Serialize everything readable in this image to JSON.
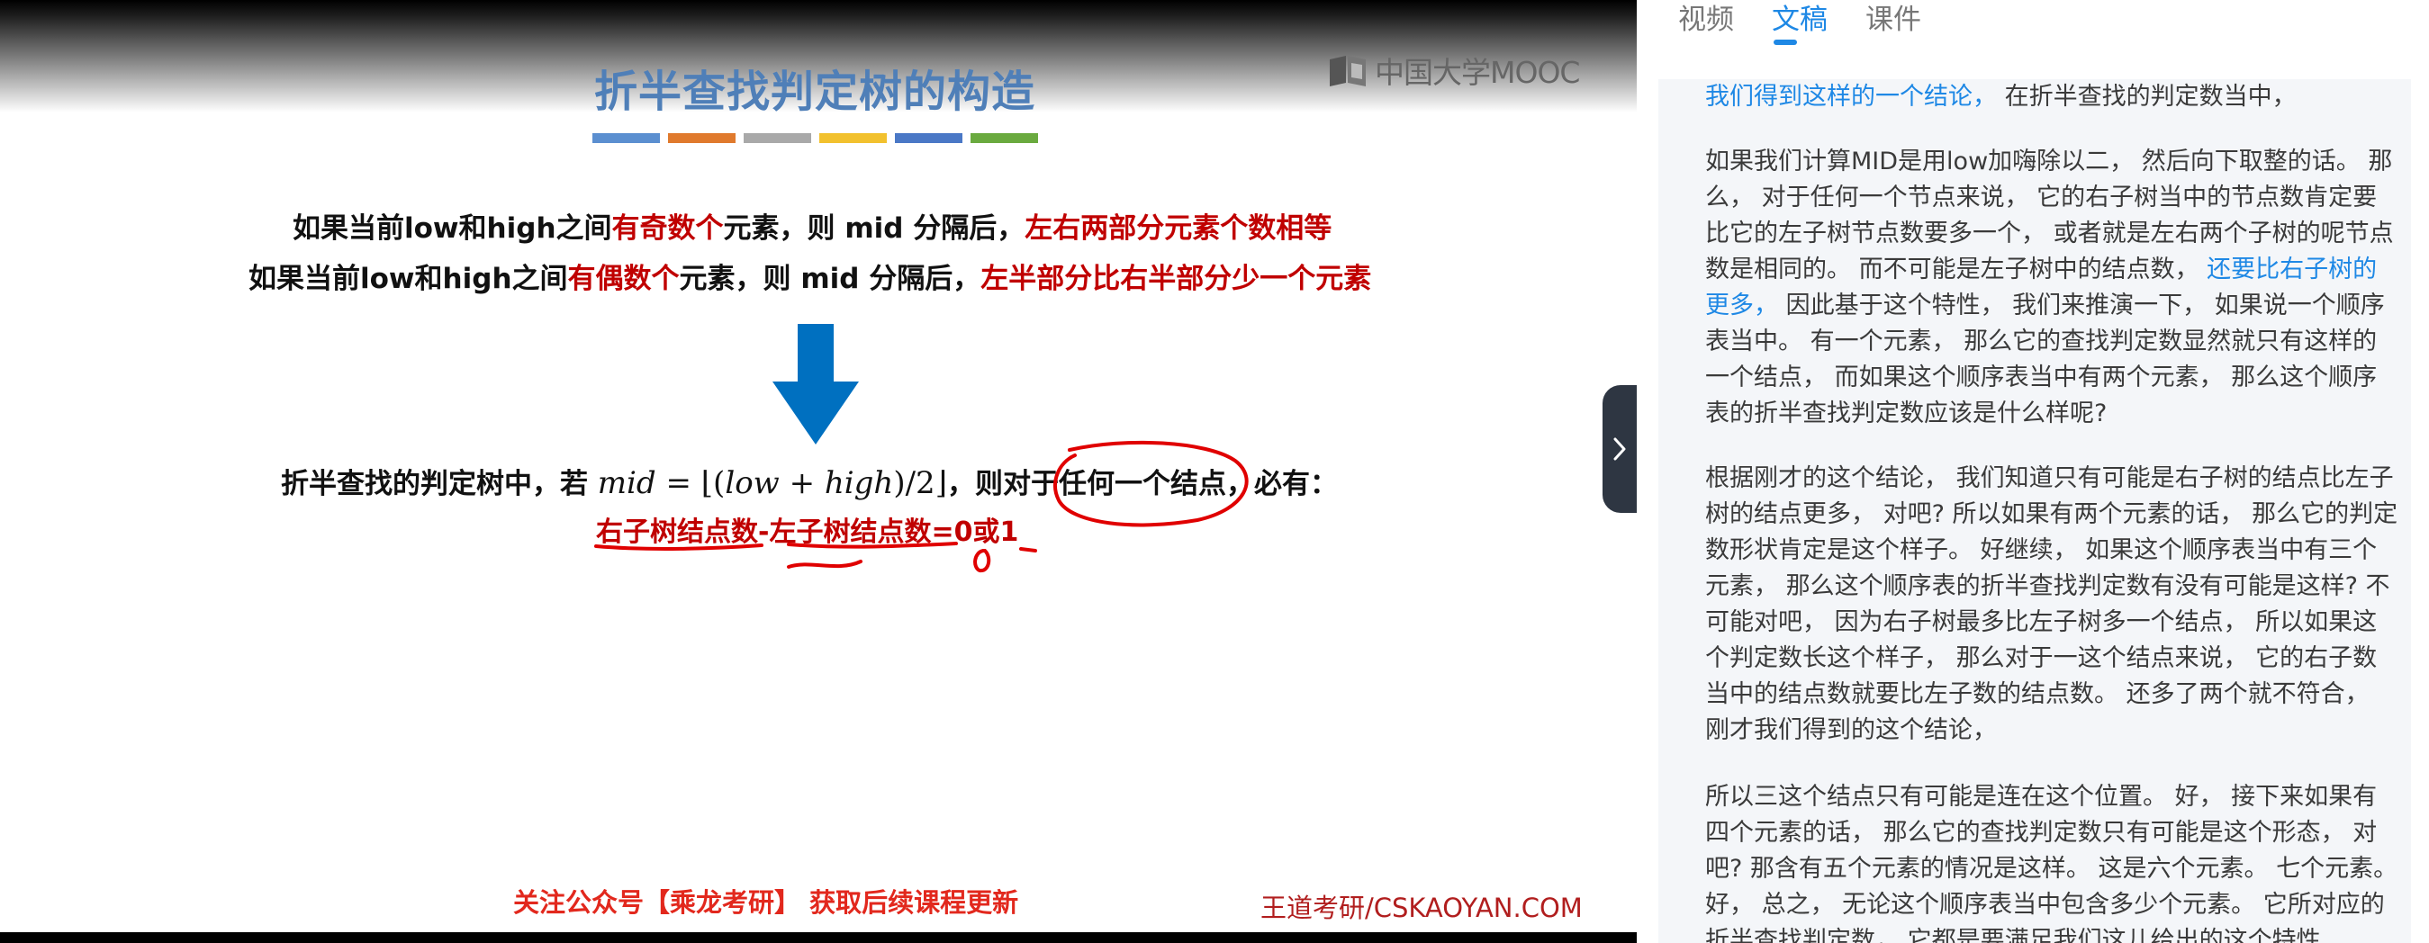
{
  "slide": {
    "title": "折半查找判定树的构造",
    "logo_text": "中国大学MOOC",
    "title_bar_colors": [
      "#5b8fd0",
      "#e07a2d",
      "#a9a9a9",
      "#f2c12e",
      "#4a78c6",
      "#6aaa3f"
    ],
    "line1": {
      "part1": "如果当前low和high之间",
      "part2": "有奇数个",
      "part3": "元素，则 mid 分隔后，",
      "part4": "左右两部分元素个数相等"
    },
    "line2": {
      "part1": "如果当前low和high之间",
      "part2": "有偶数个",
      "part3": "元素，则 mid 分隔后，",
      "part4": "左半部分比右半部分少一个元素"
    },
    "formula": {
      "prefix": "折半查找的判定树中，若 ",
      "math_lhs": "mid",
      "math_eq": " = ⌊(",
      "math_low": "low",
      "math_plus": " + ",
      "math_high": "high",
      "math_div": ")/2⌋",
      "suffix": "，则对于任何一个结点，必有："
    },
    "result": "右子树结点数-左子树结点数=0或1",
    "footer_left": "关注公众号【乘龙考研】 获取后续课程更新",
    "footer_right": "王道考研/CSKAOYAN.COM",
    "colors": {
      "title": "#4f7fb8",
      "red": "#c00000",
      "arrow": "#0070c0",
      "ink": "#e00000"
    }
  },
  "panel": {
    "tabs": [
      {
        "label": "视频"
      },
      {
        "label": "文稿"
      },
      {
        "label": "课件"
      }
    ],
    "active_tab": "文稿",
    "paragraphs": [
      {
        "p1_highlight": "我们得到这样的一个结论，",
        "p1_text": " 在折半查找的判定数当中，"
      },
      {
        "p2_text_a": "如果我们计算MID是用low加嗨除以二， 然后向下取整的话。 那么， 对于任何一个节点来说， 它的右子树当中的节点数肯定要比它的左子树节点数要多一个， 或者就是左右两个子树的呢节点数是相同的。 而不可能是左子树中的结点数， ",
        "p2_highlight": "还要比右子树的更多，",
        "p2_text_b": " 因此基于这个特性， 我们来推演一下， 如果说一个顺序表当中。 有一个元素， 那么它的查找判定数显然就只有这样的一个结点， 而如果这个顺序表当中有两个元素， 那么这个顺序表的折半查找判定数应该是什么样呢?"
      },
      {
        "p3_text": "根据刚才的这个结论， 我们知道只有可能是右子树的结点比左子树的结点更多， 对吧? 所以如果有两个元素的话， 那么它的判定数形状肯定是这个样子。 好继续， 如果这个顺序表当中有三个元素， 那么这个顺序表的折半查找判定数有没有可能是这样? 不可能对吧， 因为右子树最多比左子树多一个结点， 所以如果这个判定数长这个样子， 那么对于一这个结点来说， 它的右子数当中的结点数就要比左子数的结点数。 还多了两个就不符合， 刚才我们得到的这个结论，"
      },
      {
        "p4_text": "所以三这个结点只有可能是连在这个位置。 好， 接下来如果有四个元素的话， 那么它的查找判定数只有可能是这个形态， 对吧? 那含有五个元素的情况是这样。 这是六个元素。 七个元素。 好， 总之， 无论这个顺序表当中包含多少个元素。 它所对应的折半查找判定数， 它都是要满足我们这儿给出的这个特性"
      }
    ],
    "colors": {
      "accent": "#1e88e5",
      "transcript_bg": "#f4f6f9"
    }
  },
  "toggle": {
    "icon": "chevron-right-icon"
  }
}
